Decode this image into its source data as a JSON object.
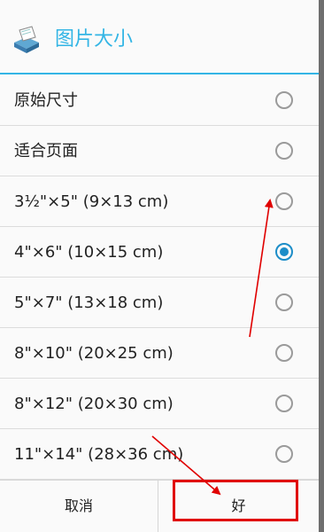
{
  "dialog": {
    "title": "图片大小",
    "icon": "printer-app-icon",
    "accent_color": "#33b5e5",
    "options": [
      {
        "label": "原始尺寸",
        "selected": false
      },
      {
        "label": "适合页面",
        "selected": false
      },
      {
        "label": "3½\"×5\" (9×13 cm)",
        "selected": false
      },
      {
        "label": "4\"×6\" (10×15 cm)",
        "selected": true
      },
      {
        "label": "5\"×7\" (13×18 cm)",
        "selected": false
      },
      {
        "label": "8\"×10\" (20×25 cm)",
        "selected": false
      },
      {
        "label": "8\"×12\" (20×30 cm)",
        "selected": false
      },
      {
        "label": "11\"×14\" (28×36 cm)",
        "selected": false
      }
    ],
    "buttons": {
      "cancel": "取消",
      "ok": "好"
    }
  },
  "annotation_color": "#e00000"
}
